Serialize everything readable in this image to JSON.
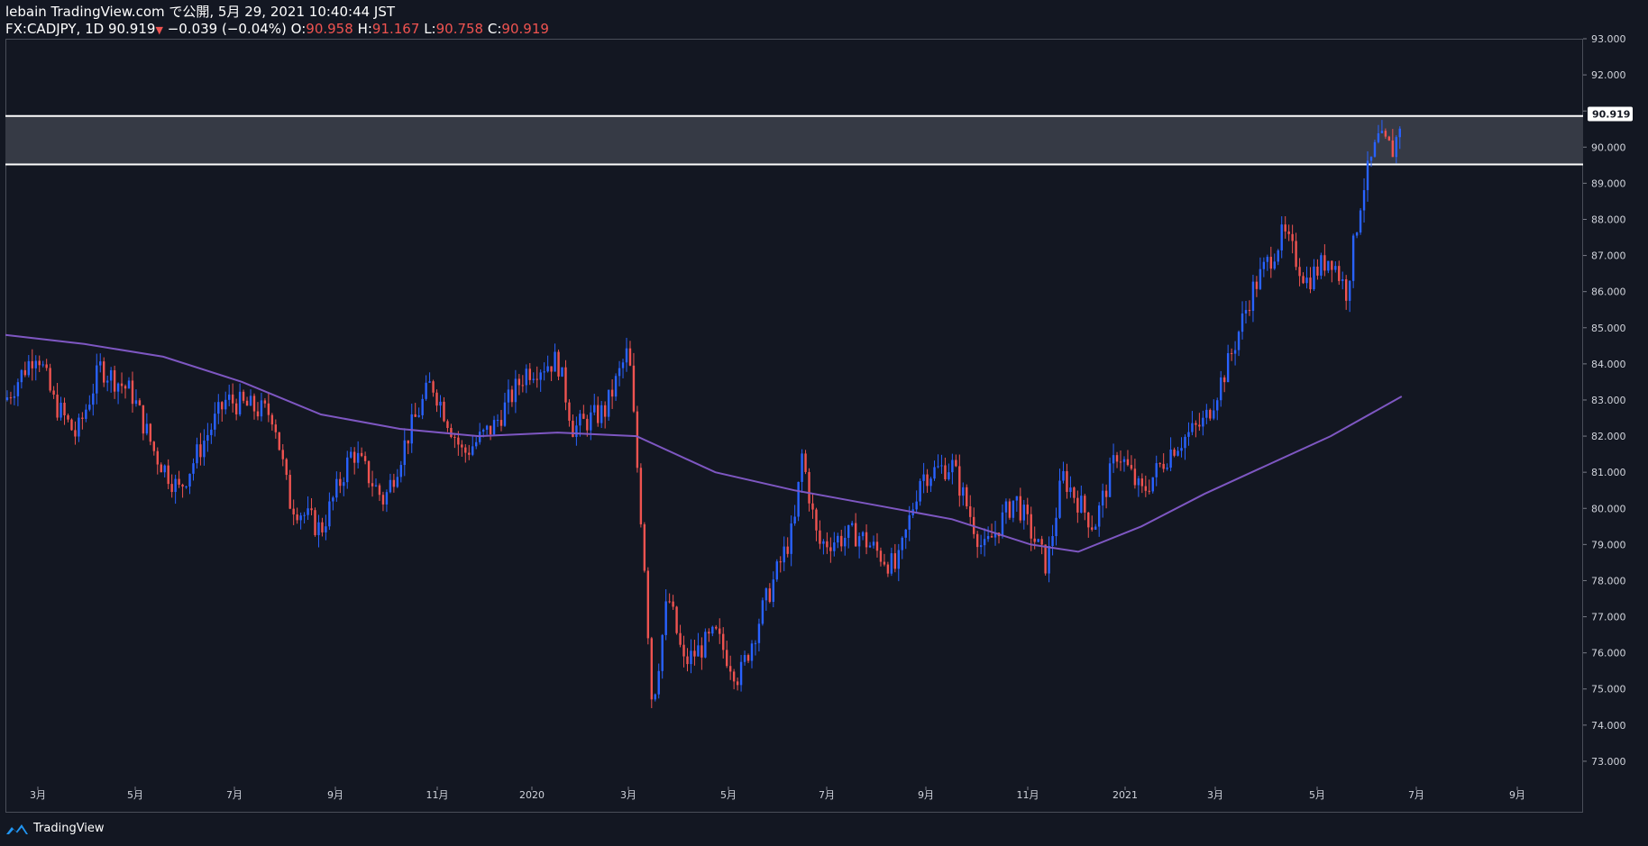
{
  "header": {
    "published": "lebain TradingView.com で公開, 5月 29, 2021 10:40:44 JST",
    "symbol": "FX:CADJPY, 1D 90.919",
    "change": "−0.039 (−0.04%)",
    "o_label": "O:",
    "o_value": "90.958",
    "h_label": "H:",
    "h_value": "91.167",
    "l_label": "L:",
    "l_value": "90.758",
    "c_label": "C:",
    "c_value": "90.919"
  },
  "footer": {
    "brand": "TradingView"
  },
  "colors": {
    "background": "#131722",
    "up": "#2962ff",
    "down": "#ef5350",
    "ma": "#7e57c2",
    "zone": "#363a45",
    "zone_line": "#ffffff",
    "axis_text": "#d1d4dc"
  },
  "chart_data": {
    "type": "candlestick",
    "symbol": "FX:CADJPY",
    "interval": "1D",
    "last_price_label": "90.919",
    "y_ticks": [
      "93.000",
      "92.000",
      "91.000",
      "90.000",
      "89.000",
      "88.000",
      "87.000",
      "86.000",
      "85.000",
      "84.000",
      "83.000",
      "82.000",
      "81.000",
      "80.000",
      "79.000",
      "78.000",
      "77.000",
      "76.000",
      "75.000",
      "74.000",
      "73.000"
    ],
    "ylim": [
      72.3,
      93.0
    ],
    "x_tick_labels": [
      "3月",
      "5月",
      "7月",
      "9月",
      "11月",
      "2020",
      "3月",
      "5月",
      "7月",
      "9月",
      "11月",
      "2021",
      "3月",
      "5月",
      "7月",
      "9月"
    ],
    "zone": {
      "top": 90.86,
      "bottom": 89.52
    },
    "close_path": [
      {
        "x": 0,
        "y": 83.0
      },
      {
        "x": 0.02,
        "y": 84.4
      },
      {
        "x": 0.03,
        "y": 83.0
      },
      {
        "x": 0.045,
        "y": 82.0
      },
      {
        "x": 0.06,
        "y": 83.9
      },
      {
        "x": 0.08,
        "y": 83.2
      },
      {
        "x": 0.095,
        "y": 81.5
      },
      {
        "x": 0.11,
        "y": 80.5
      },
      {
        "x": 0.125,
        "y": 81.8
      },
      {
        "x": 0.14,
        "y": 83.0
      },
      {
        "x": 0.17,
        "y": 82.6
      },
      {
        "x": 0.18,
        "y": 80.2
      },
      {
        "x": 0.2,
        "y": 79.4
      },
      {
        "x": 0.22,
        "y": 81.6
      },
      {
        "x": 0.24,
        "y": 80.2
      },
      {
        "x": 0.255,
        "y": 82.0
      },
      {
        "x": 0.27,
        "y": 83.5
      },
      {
        "x": 0.29,
        "y": 81.5
      },
      {
        "x": 0.31,
        "y": 82.3
      },
      {
        "x": 0.33,
        "y": 83.8
      },
      {
        "x": 0.35,
        "y": 84.1
      },
      {
        "x": 0.36,
        "y": 82.2
      },
      {
        "x": 0.38,
        "y": 82.7
      },
      {
        "x": 0.395,
        "y": 84.4
      },
      {
        "x": 0.405,
        "y": 78.5
      },
      {
        "x": 0.41,
        "y": 74.5
      },
      {
        "x": 0.42,
        "y": 77.6
      },
      {
        "x": 0.43,
        "y": 75.7
      },
      {
        "x": 0.45,
        "y": 76.5
      },
      {
        "x": 0.465,
        "y": 75.3
      },
      {
        "x": 0.48,
        "y": 77.2
      },
      {
        "x": 0.5,
        "y": 79.5
      },
      {
        "x": 0.505,
        "y": 81.5
      },
      {
        "x": 0.515,
        "y": 79.0
      },
      {
        "x": 0.54,
        "y": 79.3
      },
      {
        "x": 0.565,
        "y": 78.3
      },
      {
        "x": 0.58,
        "y": 80.9
      },
      {
        "x": 0.6,
        "y": 81.2
      },
      {
        "x": 0.62,
        "y": 78.8
      },
      {
        "x": 0.64,
        "y": 80.3
      },
      {
        "x": 0.66,
        "y": 78.4
      },
      {
        "x": 0.67,
        "y": 80.9
      },
      {
        "x": 0.69,
        "y": 79.5
      },
      {
        "x": 0.705,
        "y": 81.6
      },
      {
        "x": 0.72,
        "y": 80.4
      },
      {
        "x": 0.74,
        "y": 81.7
      },
      {
        "x": 0.76,
        "y": 82.4
      },
      {
        "x": 0.775,
        "y": 84.0
      },
      {
        "x": 0.79,
        "y": 86.0
      },
      {
        "x": 0.81,
        "y": 87.6
      },
      {
        "x": 0.825,
        "y": 86.3
      },
      {
        "x": 0.84,
        "y": 87.0
      },
      {
        "x": 0.85,
        "y": 86.0
      },
      {
        "x": 0.86,
        "y": 88.8
      },
      {
        "x": 0.87,
        "y": 90.2
      },
      {
        "x": 0.88,
        "y": 89.9
      },
      {
        "x": 0.885,
        "y": 90.9
      }
    ],
    "moving_average": {
      "name": "",
      "points": [
        {
          "x": 0,
          "y": 84.8
        },
        {
          "x": 0.05,
          "y": 84.55
        },
        {
          "x": 0.1,
          "y": 84.2
        },
        {
          "x": 0.15,
          "y": 83.5
        },
        {
          "x": 0.2,
          "y": 82.6
        },
        {
          "x": 0.25,
          "y": 82.2
        },
        {
          "x": 0.3,
          "y": 82.0
        },
        {
          "x": 0.35,
          "y": 82.1
        },
        {
          "x": 0.4,
          "y": 82.0
        },
        {
          "x": 0.45,
          "y": 81.0
        },
        {
          "x": 0.5,
          "y": 80.5
        },
        {
          "x": 0.55,
          "y": 80.1
        },
        {
          "x": 0.6,
          "y": 79.7
        },
        {
          "x": 0.65,
          "y": 79.0
        },
        {
          "x": 0.68,
          "y": 78.8
        },
        {
          "x": 0.72,
          "y": 79.5
        },
        {
          "x": 0.76,
          "y": 80.4
        },
        {
          "x": 0.8,
          "y": 81.2
        },
        {
          "x": 0.84,
          "y": 82.0
        },
        {
          "x": 0.885,
          "y": 83.1
        }
      ]
    }
  }
}
